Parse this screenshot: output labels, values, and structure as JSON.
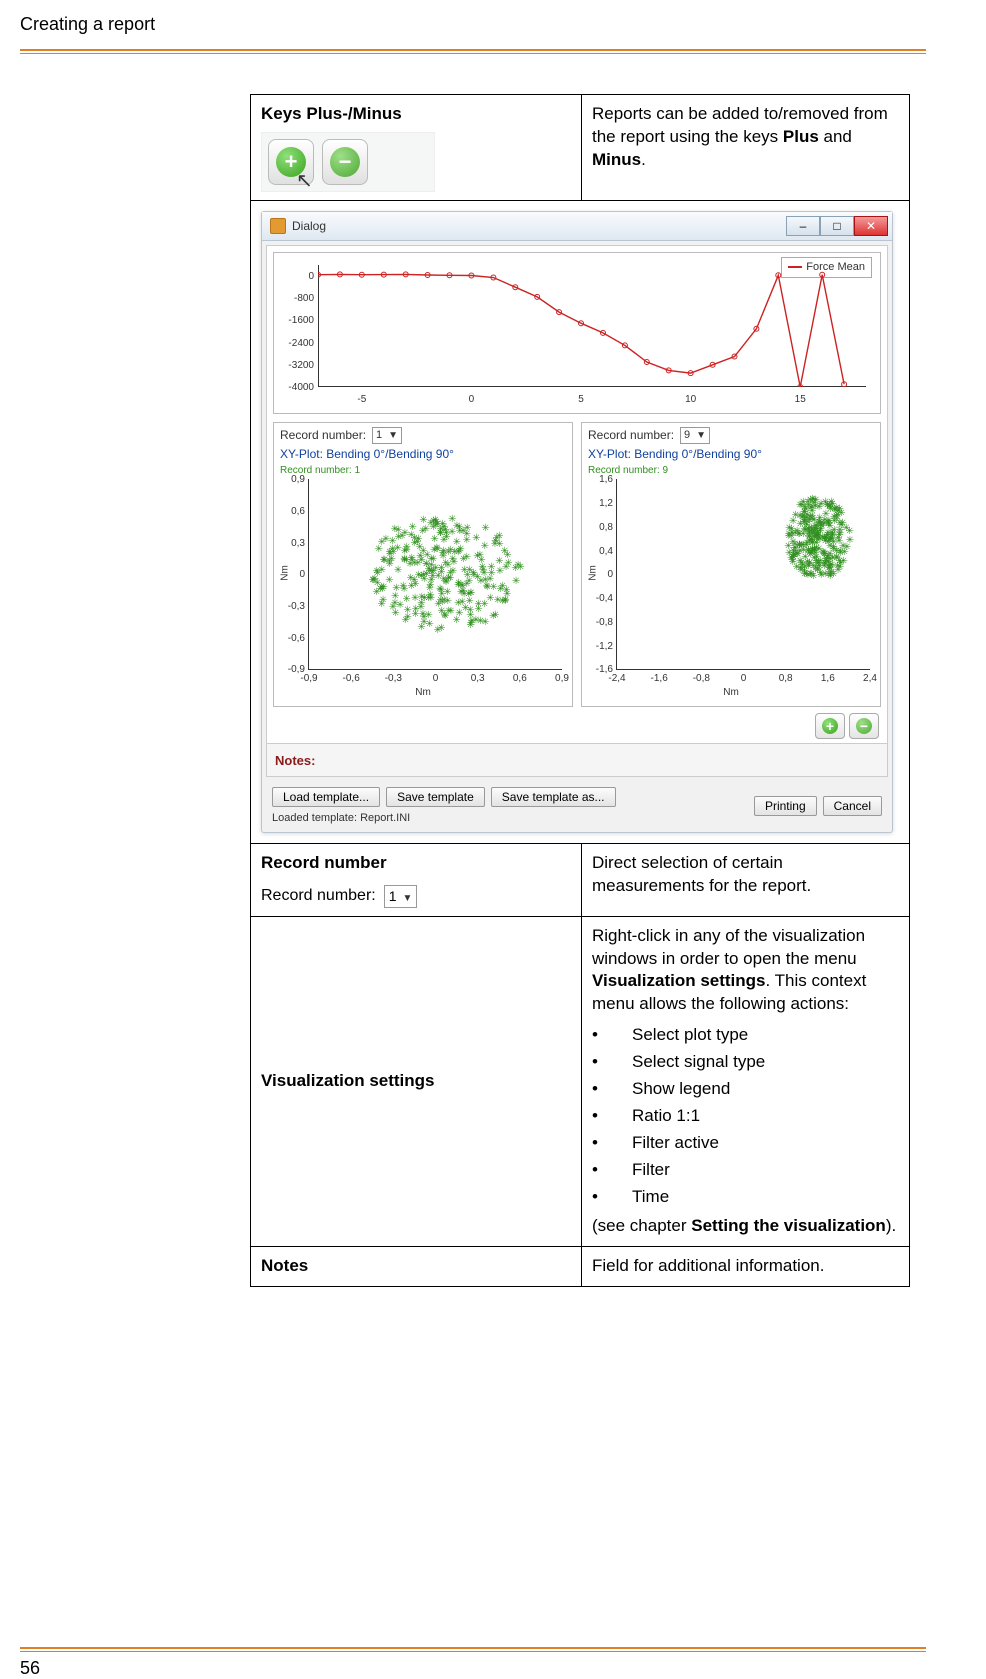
{
  "header": {
    "title": "Creating a report"
  },
  "footer": {
    "page": "56"
  },
  "rows": {
    "keys": {
      "title": "Keys Plus-/Minus",
      "desc_pre": "Reports can be added to/removed from the report using the keys ",
      "desc_plus": "Plus",
      "desc_and": " and ",
      "desc_minus": "Minus",
      "desc_post": "."
    },
    "record_number": {
      "title": "Record number",
      "label": "Record number:",
      "value": "1",
      "desc": "Direct selection of certain measurements for the report."
    },
    "viz": {
      "title": "Visualization settings",
      "intro_pre": "Right-click in any of the visualization windows in order to open the menu ",
      "intro_bold": "Visualization settings",
      "intro_post": ". This context menu allows the following actions:",
      "bullets": [
        "Select plot type",
        "Select signal type",
        "Show legend",
        "Ratio 1:1",
        "Filter active",
        "Filter",
        "Time"
      ],
      "see_pre": "(see chapter ",
      "see_bold": "Setting the visualization",
      "see_post": ")."
    },
    "notes": {
      "title": "Notes",
      "desc": "Field for additional information."
    }
  },
  "dialog": {
    "title": "Dialog",
    "legend": "Force Mean",
    "notes_label": "Notes:",
    "buttons": {
      "load": "Load template...",
      "save": "Save template",
      "saveas": "Save template as...",
      "print": "Printing",
      "cancel": "Cancel"
    },
    "loaded": "Loaded template: Report.INI",
    "panel_left": {
      "rn_label": "Record number:",
      "rn_value": "1",
      "title": "XY-Plot:  Bending 0°/Bending 90°",
      "sub": "Record number: 1",
      "xlab": "Nm",
      "ylab": "Nm"
    },
    "panel_right": {
      "rn_label": "Record number:",
      "rn_value": "9",
      "title": "XY-Plot:  Bending 0°/Bending 90°",
      "sub": "Record number: 9",
      "xlab": "Nm",
      "ylab": "Nm"
    }
  },
  "chart_data": [
    {
      "type": "line",
      "title": "",
      "xlabel": "",
      "ylabel": "",
      "ylim": [
        -4000,
        400
      ],
      "xlim": [
        -7,
        18
      ],
      "series": [
        {
          "name": "Force Mean",
          "x": [
            -7,
            -6,
            -5,
            -4,
            -3,
            -2,
            -1,
            0,
            1,
            2,
            3,
            4,
            5,
            6,
            7,
            8,
            9,
            10,
            11,
            12,
            13,
            14,
            15,
            16,
            17
          ],
          "y": [
            50,
            60,
            50,
            55,
            60,
            40,
            30,
            20,
            -50,
            -400,
            -750,
            -1300,
            -1700,
            -2050,
            -2500,
            -3100,
            -3400,
            -3500,
            -3200,
            -2900,
            -1900,
            30,
            -4000,
            50,
            -3900
          ]
        }
      ],
      "xticks": [
        -5,
        0,
        5,
        10,
        15
      ],
      "yticks": [
        0,
        -800,
        -1600,
        -2400,
        -3200,
        -4000
      ]
    },
    {
      "type": "scatter",
      "title": "XY-Plot:  Bending 0°/Bending 90°",
      "xlabel": "Nm",
      "ylabel": "Nm",
      "xlim": [
        -0.9,
        0.9
      ],
      "ylim": [
        -0.9,
        0.9
      ],
      "xticks": [
        -0.9,
        -0.6,
        -0.3,
        0,
        0.3,
        0.6,
        0.9
      ],
      "yticks": [
        -0.9,
        -0.6,
        -0.3,
        0,
        0.3,
        0.6,
        0.9
      ]
    },
    {
      "type": "scatter",
      "title": "XY-Plot:  Bending 0°/Bending 90°",
      "xlabel": "Nm",
      "ylabel": "Nm",
      "xlim": [
        -2.4,
        2.4
      ],
      "ylim": [
        -1.6,
        1.6
      ],
      "xticks": [
        -2.4,
        -1.6,
        -0.8,
        0,
        0.8,
        1.6,
        2.4
      ],
      "yticks": [
        -1.6,
        -1.2,
        -0.8,
        -0.4,
        0,
        0.4,
        0.8,
        1.2,
        1.6
      ]
    }
  ]
}
